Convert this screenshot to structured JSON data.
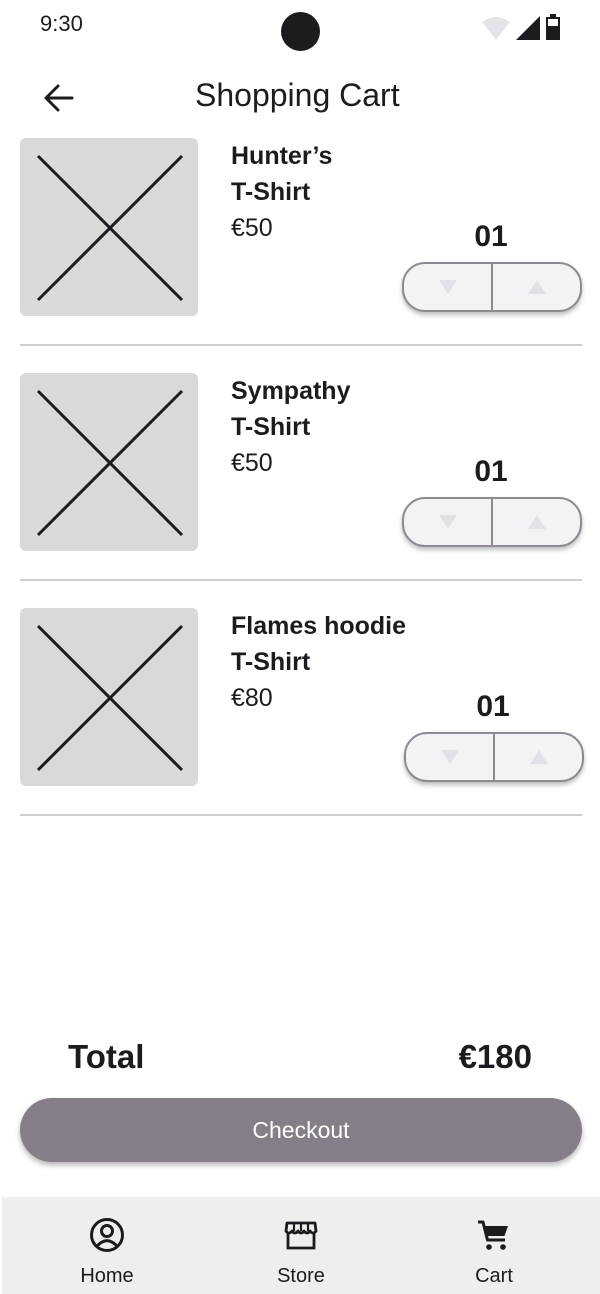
{
  "status_bar": {
    "time": "9:30",
    "icons": [
      "wifi-icon",
      "signal-icon",
      "battery-icon"
    ]
  },
  "app_bar": {
    "title": "Shopping Cart",
    "back_icon": "arrow-left-icon"
  },
  "cart_items": [
    {
      "name": "Hunter’s",
      "type": "T-Shirt",
      "price": "€50",
      "quantity": "01"
    },
    {
      "name": "Sympathy",
      "type": "T-Shirt",
      "price": "€50",
      "quantity": "01"
    },
    {
      "name": "Flames hoodie",
      "type": "T-Shirt",
      "price": "€80",
      "quantity": "01"
    }
  ],
  "summary": {
    "total_label": "Total",
    "total_value": "€180",
    "checkout_label": "Checkout"
  },
  "bottom_nav": [
    {
      "label": "Home",
      "icon": "account-circle-icon"
    },
    {
      "label": "Store",
      "icon": "store-icon"
    },
    {
      "label": "Cart",
      "icon": "cart-icon"
    }
  ],
  "colors": {
    "primary_button": "#857e88",
    "thumbnail_placeholder": "#d9d9d9",
    "nav_background": "#eeeeee",
    "stepper_background": "#f4f2f5"
  }
}
